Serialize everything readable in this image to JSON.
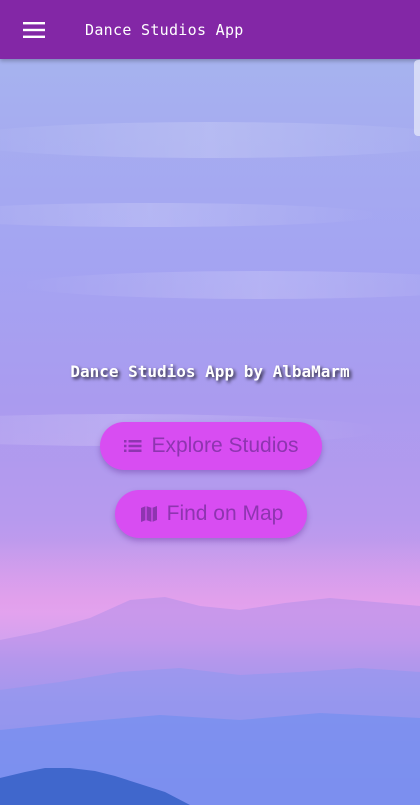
{
  "app_bar": {
    "title": "Dance Studios App",
    "menu_icon": "hamburger-menu-icon",
    "background_color": "#8327a6"
  },
  "main": {
    "headline": "Dance Studios App by AlbaMarm",
    "buttons": [
      {
        "label": "Explore Studios",
        "icon": "list-icon"
      },
      {
        "label": "Find on Map",
        "icon": "map-icon"
      }
    ],
    "button_color": "#d84df2",
    "button_text_color": "#8e35b0"
  }
}
